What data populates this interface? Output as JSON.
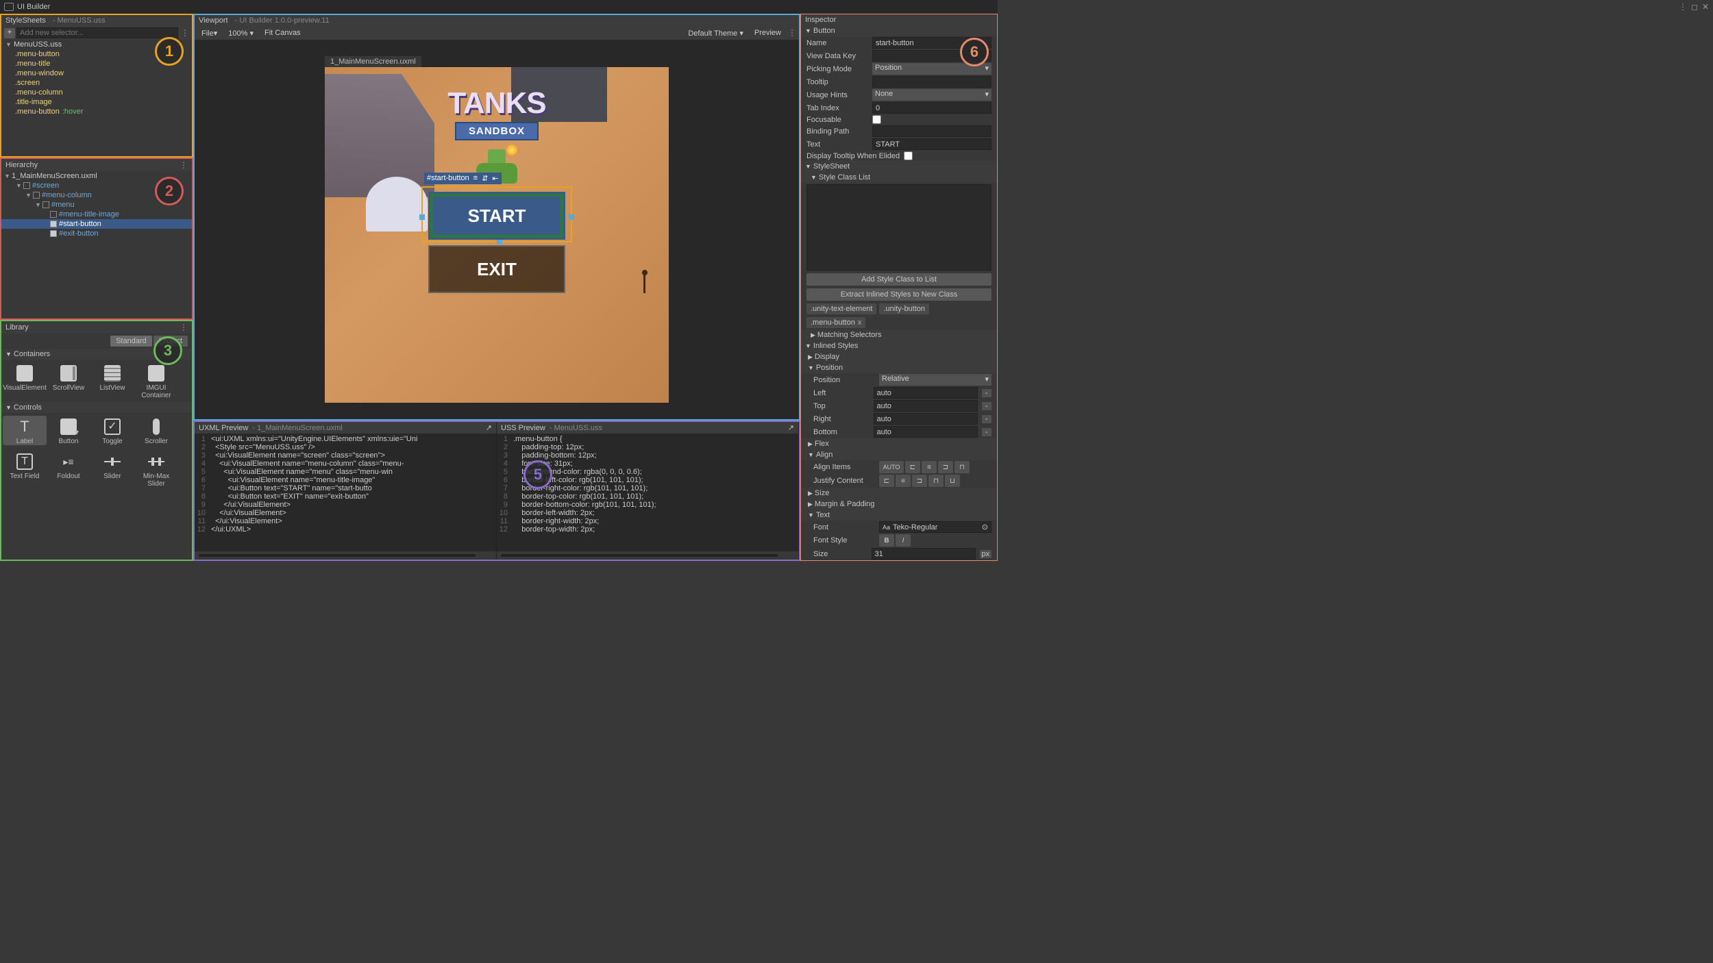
{
  "window": {
    "title": "UI Builder"
  },
  "stylesheets": {
    "title": "StyleSheets",
    "file": "MenuUSS.uss",
    "add_placeholder": "Add new selector...",
    "root_file": "MenuUSS.uss",
    "selectors": [
      ".menu-button",
      ".menu-title",
      ".menu-window",
      ".screen",
      ".menu-column",
      ".title-image"
    ],
    "hover_selector": ".menu-button",
    "hover_pseudo": ":hover"
  },
  "hierarchy": {
    "title": "Hierarchy",
    "file": "1_MainMenuScreen.uxml",
    "tree": [
      {
        "id": "#screen",
        "depth": 0,
        "sel": false
      },
      {
        "id": "#menu-column",
        "depth": 1,
        "sel": false
      },
      {
        "id": "#menu",
        "depth": 2,
        "sel": false
      },
      {
        "id": "#menu-title-image",
        "depth": 3,
        "sel": false
      },
      {
        "id": "#start-button",
        "depth": 3,
        "sel": true
      },
      {
        "id": "#exit-button",
        "depth": 3,
        "sel": false
      }
    ]
  },
  "library": {
    "title": "Library",
    "tabs": {
      "standard": "Standard",
      "project": "Project"
    },
    "sections": {
      "containers": "Containers",
      "controls": "Controls"
    },
    "containers": [
      "VisualElement",
      "ScrollView",
      "ListView",
      "IMGUI Container"
    ],
    "controls": [
      "Label",
      "Button",
      "Toggle",
      "Scroller",
      "Text Field",
      "Foldout",
      "Slider",
      "Min-Max Slider"
    ]
  },
  "viewport": {
    "title": "Viewport",
    "sub": "UI Builder 1.0.0-preview.11",
    "file_menu": "File",
    "zoom": "100%",
    "fit": "Fit Canvas",
    "theme": "Default Theme",
    "preview": "Preview",
    "canvas_tab": "1_MainMenuScreen.uxml",
    "logo_top": "TANKS",
    "logo_sub": "SANDBOX",
    "start_label": "START",
    "exit_label": "EXIT",
    "selection_label": "#start-button"
  },
  "uxml_preview": {
    "title": "UXML Preview",
    "file": "1_MainMenuScreen.uxml",
    "lines": [
      "<ui:UXML xmlns:ui=\"UnityEngine.UIElements\" xmlns:uie=\"Uni",
      "  <Style src=\"MenuUSS.uss\" />",
      "  <ui:VisualElement name=\"screen\" class=\"screen\">",
      "    <ui:VisualElement name=\"menu-column\" class=\"menu-",
      "      <ui:VisualElement name=\"menu\" class=\"menu-win",
      "        <ui:VisualElement name=\"menu-title-image\"",
      "        <ui:Button text=\"START\" name=\"start-butto",
      "        <ui:Button text=\"EXIT\" name=\"exit-button\"",
      "      </ui:VisualElement>",
      "    </ui:VisualElement>",
      "  </ui:VisualElement>",
      "</ui:UXML>"
    ]
  },
  "uss_preview": {
    "title": "USS Preview",
    "file": "MenuUSS.uss",
    "lines": [
      ".menu-button {",
      "    padding-top: 12px;",
      "    padding-bottom: 12px;",
      "    font-size: 31px;",
      "    background-color: rgba(0, 0, 0, 0.6);",
      "    border-left-color: rgb(101, 101, 101);",
      "    border-right-color: rgb(101, 101, 101);",
      "    border-top-color: rgb(101, 101, 101);",
      "    border-bottom-color: rgb(101, 101, 101);",
      "    border-left-width: 2px;",
      "    border-right-width: 2px;",
      "    border-top-width: 2px;"
    ]
  },
  "inspector": {
    "title": "Inspector",
    "section": "Button",
    "fields": {
      "name_l": "Name",
      "name_v": "start-button",
      "vdk_l": "View Data Key",
      "pick_l": "Picking Mode",
      "pick_v": "Position",
      "tooltip_l": "Tooltip",
      "usage_l": "Usage Hints",
      "usage_v": "None",
      "tab_l": "Tab Index",
      "tab_v": "0",
      "focus_l": "Focusable",
      "bind_l": "Binding Path",
      "text_l": "Text",
      "text_v": "START",
      "dtwe_l": "Display Tooltip When Elided"
    },
    "stylesheet_l": "StyleSheet",
    "scl_l": "Style Class List",
    "add_class_btn": "Add Style Class to List",
    "extract_btn": "Extract Inlined Styles to New Class",
    "chips": [
      ".unity-text-element",
      ".unity-button",
      ".menu-button"
    ],
    "foldouts": {
      "matching": "Matching Selectors",
      "inlined": "Inlined Styles",
      "display": "Display",
      "position": "Position",
      "flex": "Flex",
      "align": "Align",
      "size": "Size",
      "margin": "Margin & Padding",
      "text": "Text"
    },
    "position": {
      "pos_l": "Position",
      "pos_v": "Relative",
      "left_l": "Left",
      "top_l": "Top",
      "right_l": "Right",
      "bottom_l": "Bottom",
      "auto": "auto"
    },
    "align": {
      "items_l": "Align Items",
      "auto": "AUTO",
      "justify_l": "Justify Content"
    },
    "text": {
      "font_l": "Font",
      "font_v": "Teko-Regular",
      "font_prefix": "Aa",
      "style_l": "Font Style",
      "size_l": "Size",
      "size_v": "31",
      "size_unit": "px"
    }
  }
}
